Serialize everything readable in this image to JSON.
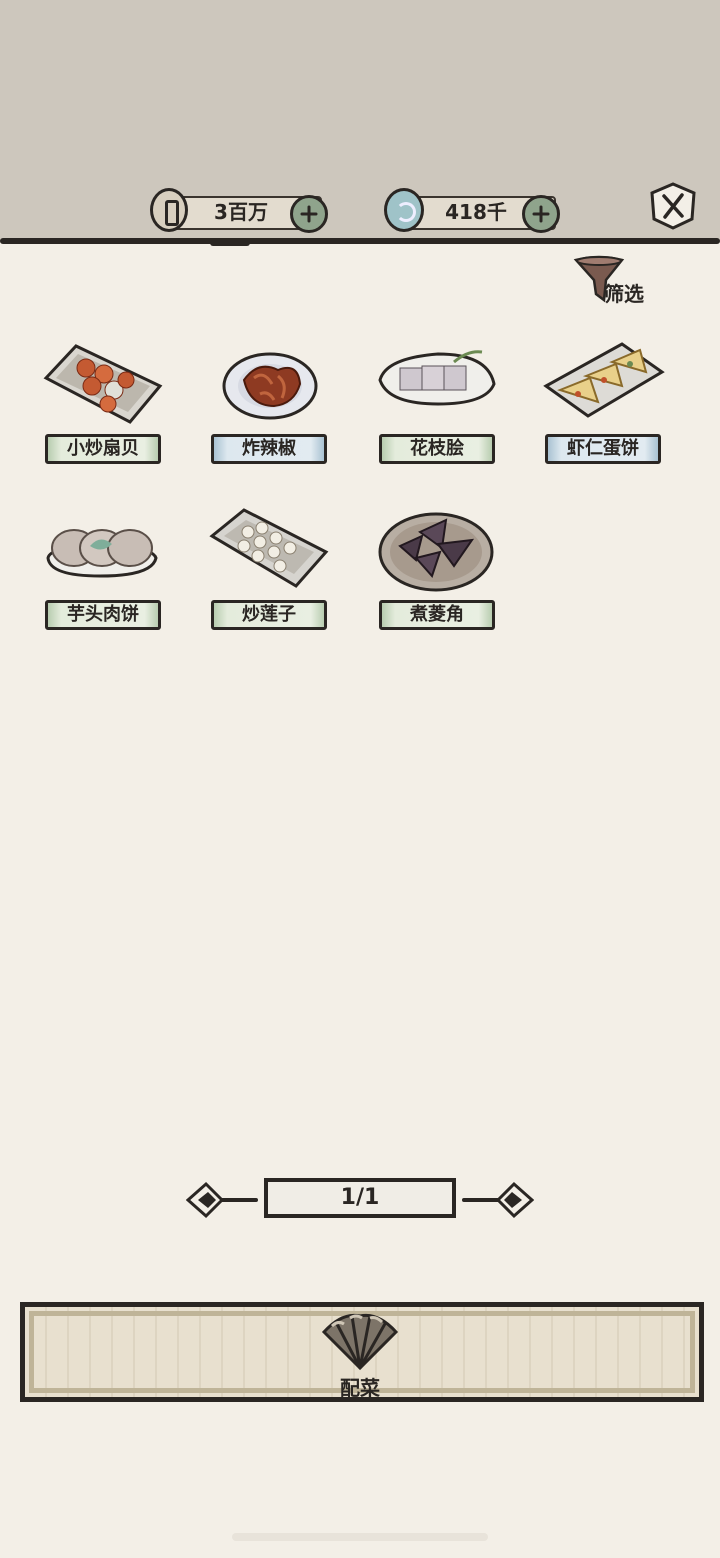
{
  "header": {
    "currency1": {
      "icon": "coin-icon",
      "value": "3百万"
    },
    "currency2": {
      "icon": "jade-icon",
      "value": "418千"
    }
  },
  "filter": {
    "label": "筛选"
  },
  "dishes": [
    {
      "name": "小炒扇贝",
      "tag_color": "green"
    },
    {
      "name": "炸辣椒",
      "tag_color": "blue"
    },
    {
      "name": "花枝脍",
      "tag_color": "green"
    },
    {
      "name": "虾仁蛋饼",
      "tag_color": "blue"
    },
    {
      "name": "芋头肉饼",
      "tag_color": "green"
    },
    {
      "name": "炒莲子",
      "tag_color": "green"
    },
    {
      "name": "煮菱角",
      "tag_color": "green"
    }
  ],
  "pager": {
    "text": "1/1"
  },
  "bottom": {
    "combine_label": "配菜"
  },
  "colors": {
    "background": "#f3efe7",
    "header": "#cdc7bd",
    "ink": "#2a2623",
    "tag_green": "#b8cdb0",
    "tag_blue": "#a9c2d2"
  }
}
